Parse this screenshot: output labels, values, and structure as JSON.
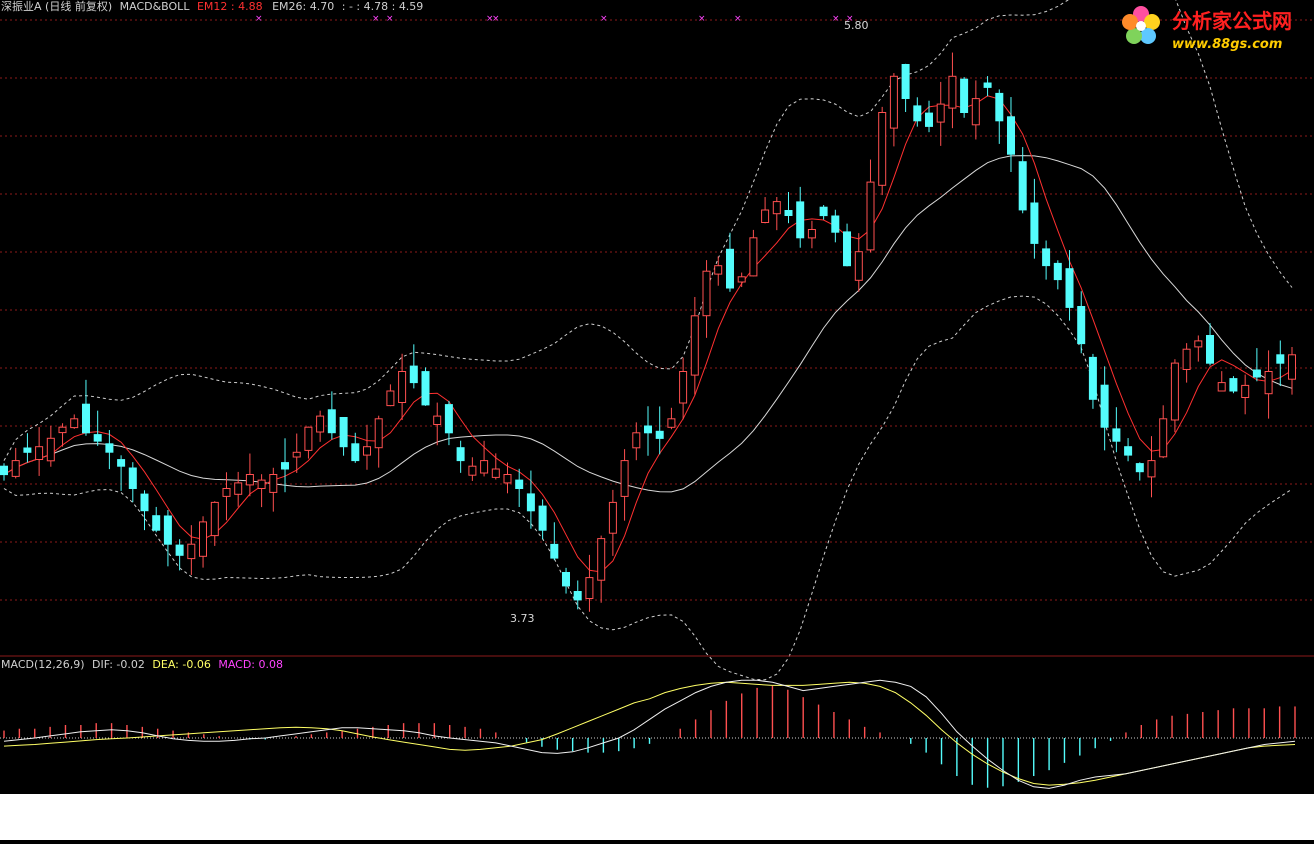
{
  "header_main": {
    "stock_name": "深振业A",
    "period": "(日线 前复权)",
    "indicator": "MACD&BOLL",
    "em12_label": "EM12",
    "em12_value": ": 4.88",
    "em26_text": "EM26: 4.70",
    "rest_text": ": - : 4.78 : 4.59"
  },
  "header_macd": {
    "title": "MACD(12,26,9)",
    "dif_text": "DIF: -0.02",
    "dea_text": "DEA: -0.06",
    "macd_text": "MACD: 0.08"
  },
  "watermark": {
    "brand": "分析家公式网",
    "url": "www.88gs.com"
  },
  "colors": {
    "up": "#ff5050",
    "down": "#54fcfc",
    "ma_fast": "#ff3030",
    "ma_slow": "#d8d8d8",
    "boll": "#cfcfcf",
    "grid": "#8b1a1a",
    "dif": "#f0f0f0",
    "dea": "#ffff66",
    "macd_label": "#ff44ff"
  },
  "chart_data": {
    "type": "candlestick",
    "price_range": [
      3.62,
      5.9
    ],
    "high_mark": "5.80",
    "low_mark": "3.73",
    "x_count": 100,
    "closes": [
      4.25,
      4.3,
      4.33,
      4.35,
      4.38,
      4.42,
      4.45,
      4.4,
      4.37,
      4.33,
      4.28,
      4.2,
      4.12,
      4.05,
      4.0,
      3.96,
      4.0,
      4.08,
      4.15,
      4.2,
      4.22,
      4.25,
      4.23,
      4.25,
      4.27,
      4.33,
      4.42,
      4.46,
      4.4,
      4.35,
      4.3,
      4.35,
      4.45,
      4.55,
      4.62,
      4.58,
      4.5,
      4.46,
      4.4,
      4.3,
      4.28,
      4.3,
      4.27,
      4.25,
      4.2,
      4.12,
      4.05,
      3.95,
      3.85,
      3.8,
      3.88,
      4.02,
      4.15,
      4.3,
      4.4,
      4.4,
      4.38,
      4.45,
      4.62,
      4.82,
      4.98,
      5.0,
      4.92,
      4.96,
      5.1,
      5.2,
      5.23,
      5.18,
      5.1,
      5.13,
      5.18,
      5.12,
      5.0,
      5.05,
      5.3,
      5.55,
      5.68,
      5.6,
      5.52,
      5.5,
      5.58,
      5.68,
      5.55,
      5.6,
      5.64,
      5.52,
      5.4,
      5.2,
      5.08,
      5.0,
      4.95,
      4.85,
      4.72,
      4.52,
      4.42,
      4.37,
      4.32,
      4.26,
      4.3,
      4.45,
      4.65,
      4.7,
      4.73,
      4.65,
      4.58,
      4.55,
      4.57,
      4.6,
      4.62,
      4.65,
      4.68
    ],
    "macd": {
      "range": [
        -0.32,
        0.32
      ],
      "dif": [
        -0.02,
        -0.01,
        0.0,
        0.01,
        0.02,
        0.03,
        0.035,
        0.04,
        0.035,
        0.025,
        0.01,
        -0.005,
        -0.015,
        -0.02,
        -0.02,
        -0.015,
        -0.005,
        0.0,
        0.01,
        0.02,
        0.03,
        0.04,
        0.05,
        0.05,
        0.045,
        0.04,
        0.035,
        0.025,
        0.01,
        0.0,
        -0.01,
        -0.02,
        -0.03,
        -0.05,
        -0.07,
        -0.09,
        -0.095,
        -0.085,
        -0.06,
        -0.03,
        0.0,
        0.04,
        0.09,
        0.14,
        0.18,
        0.22,
        0.25,
        0.27,
        0.28,
        0.28,
        0.27,
        0.25,
        0.23,
        0.24,
        0.25,
        0.26,
        0.27,
        0.28,
        0.27,
        0.25,
        0.2,
        0.12,
        0.03,
        -0.05,
        -0.13,
        -0.2,
        -0.26,
        -0.3,
        -0.31,
        -0.29,
        -0.26,
        -0.24,
        -0.23,
        -0.22,
        -0.2,
        -0.18,
        -0.16,
        -0.14,
        -0.12,
        -0.1,
        -0.08,
        -0.06,
        -0.04,
        -0.03,
        -0.02
      ],
      "dea": [
        -0.05,
        -0.045,
        -0.04,
        -0.032,
        -0.025,
        -0.018,
        -0.01,
        -0.005,
        0.0,
        0.005,
        0.01,
        0.015,
        0.02,
        0.025,
        0.03,
        0.035,
        0.04,
        0.045,
        0.05,
        0.052,
        0.05,
        0.045,
        0.035,
        0.02,
        0.005,
        -0.01,
        -0.025,
        -0.04,
        -0.055,
        -0.07,
        -0.075,
        -0.07,
        -0.06,
        -0.05,
        -0.03,
        -0.01,
        0.02,
        0.05,
        0.08,
        0.11,
        0.14,
        0.17,
        0.19,
        0.22,
        0.24,
        0.255,
        0.265,
        0.27,
        0.265,
        0.26,
        0.255,
        0.255,
        0.255,
        0.26,
        0.265,
        0.27,
        0.265,
        0.25,
        0.22,
        0.17,
        0.11,
        0.04,
        -0.03,
        -0.1,
        -0.16,
        -0.21,
        -0.25,
        -0.28,
        -0.29,
        -0.285,
        -0.275,
        -0.26,
        -0.24,
        -0.22,
        -0.2,
        -0.18,
        -0.16,
        -0.14,
        -0.12,
        -0.1,
        -0.08,
        -0.06,
        -0.05,
        -0.045,
        -0.04
      ],
      "hist": [
        0.04,
        0.05,
        0.05,
        0.06,
        0.07,
        0.07,
        0.08,
        0.08,
        0.07,
        0.06,
        0.05,
        0.04,
        0.03,
        0.02,
        0.01,
        0.0,
        -0.01,
        -0.01,
        0.0,
        0.01,
        0.02,
        0.03,
        0.04,
        0.05,
        0.06,
        0.07,
        0.08,
        0.08,
        0.08,
        0.07,
        0.06,
        0.05,
        0.03,
        0.0,
        -0.03,
        -0.06,
        -0.08,
        -0.09,
        -0.1,
        -0.1,
        -0.09,
        -0.07,
        -0.04,
        0.0,
        0.05,
        0.1,
        0.15,
        0.2,
        0.24,
        0.27,
        0.28,
        0.26,
        0.22,
        0.18,
        0.14,
        0.1,
        0.06,
        0.03,
        0.0,
        -0.04,
        -0.1,
        -0.18,
        -0.26,
        -0.32,
        -0.34,
        -0.33,
        -0.3,
        -0.26,
        -0.22,
        -0.17,
        -0.12,
        -0.07,
        -0.02,
        0.03,
        0.07,
        0.1,
        0.12,
        0.13,
        0.14,
        0.15,
        0.16,
        0.16,
        0.16,
        0.17,
        0.17
      ]
    }
  }
}
